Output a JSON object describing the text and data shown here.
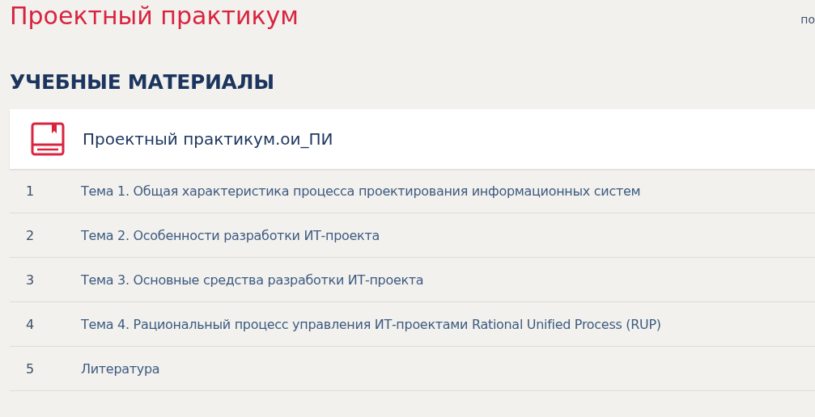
{
  "page_title": "Проектный практикум",
  "top_link": "по",
  "section_heading": "УЧЕБНЫЕ МАТЕРИАЛЫ",
  "course": {
    "title": "Проектный практикум.ои_ПИ"
  },
  "topics": [
    {
      "number": "1",
      "title": "Тема 1. Общая характеристика процесса проектирования информационных систем"
    },
    {
      "number": "2",
      "title": "Тема 2. Особенности разработки ИТ-проекта"
    },
    {
      "number": "3",
      "title": "Тема 3. Основные средства разработки ИТ-проекта"
    },
    {
      "number": "4",
      "title": "Тема 4. Рациональный процесс управления ИТ-проектами Rational Unified Process (RUP)"
    },
    {
      "number": "5",
      "title": "Литература"
    }
  ]
}
